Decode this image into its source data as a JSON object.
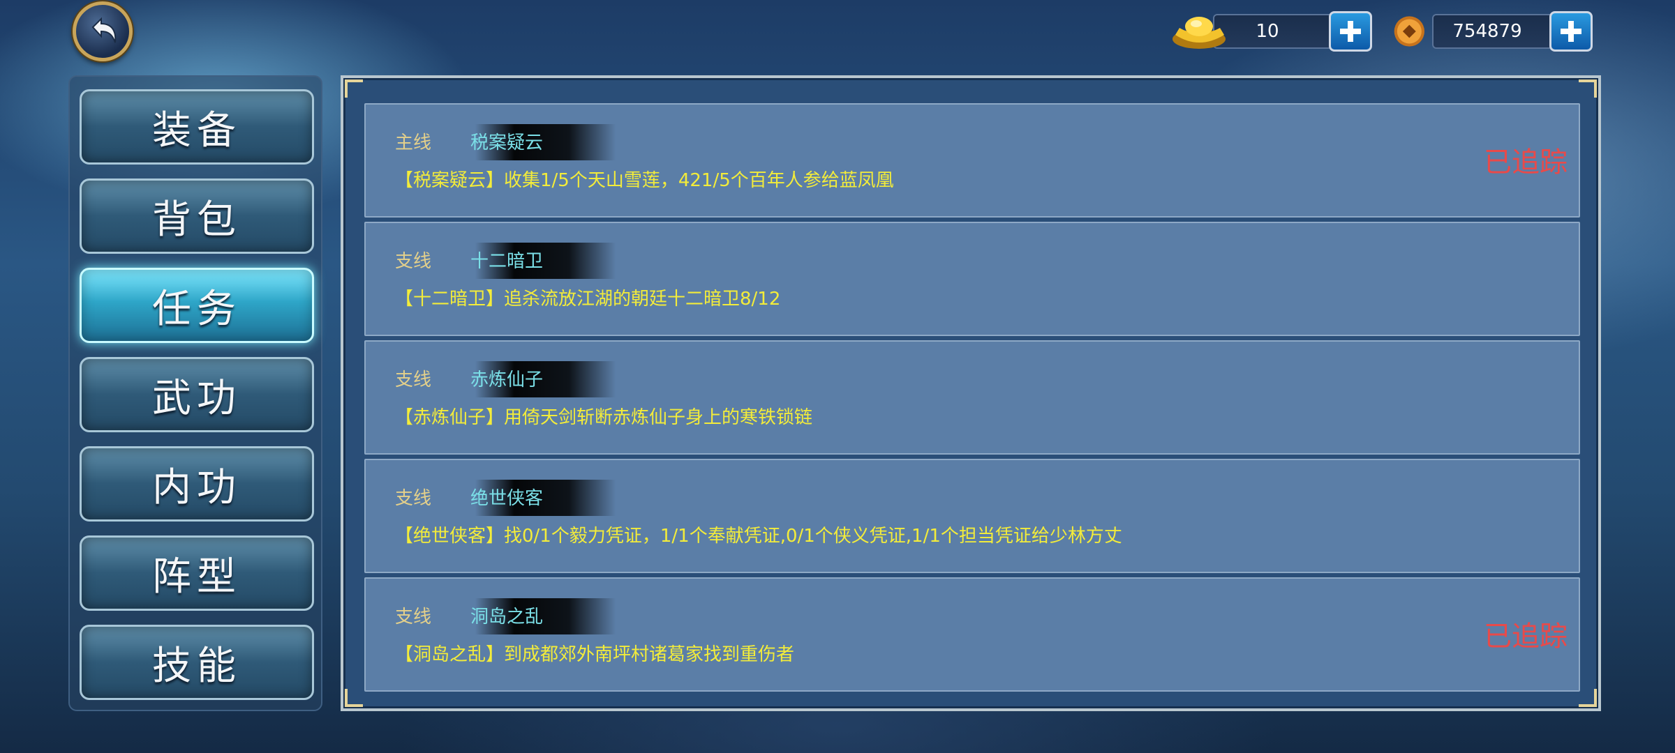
{
  "currency": {
    "gold_amount": "10",
    "coin_amount": "754879"
  },
  "sidebar": {
    "items": [
      {
        "label": "装备",
        "active": false
      },
      {
        "label": "背包",
        "active": false
      },
      {
        "label": "任务",
        "active": true
      },
      {
        "label": "武功",
        "active": false
      },
      {
        "label": "内功",
        "active": false
      },
      {
        "label": "阵型",
        "active": false
      },
      {
        "label": "技能",
        "active": false
      }
    ]
  },
  "quests": [
    {
      "type": "主线",
      "name": "税案疑云",
      "desc": "【税案疑云】收集1/5个天山雪莲，421/5个百年人参给蓝凤凰",
      "tracked": "已追踪"
    },
    {
      "type": "支线",
      "name": "十二暗卫",
      "desc": "【十二暗卫】追杀流放江湖的朝廷十二暗卫8/12",
      "tracked": ""
    },
    {
      "type": "支线",
      "name": "赤炼仙子",
      "desc": "【赤炼仙子】用倚天剑斩断赤炼仙子身上的寒铁锁链",
      "tracked": ""
    },
    {
      "type": "支线",
      "name": "绝世侠客",
      "desc": "【绝世侠客】找0/1个毅力凭证，1/1个奉献凭证,0/1个侠义凭证,1/1个担当凭证给少林方丈",
      "tracked": ""
    },
    {
      "type": "支线",
      "name": "洞岛之乱",
      "desc": "【洞岛之乱】到成都郊外南坪村诸葛家找到重伤者",
      "tracked": "已追踪"
    }
  ],
  "colors": {
    "quest_type": "#e4d08a",
    "quest_name": "#7be0e8",
    "quest_desc": "#f3ec3a",
    "tracked": "#e84a4a"
  }
}
